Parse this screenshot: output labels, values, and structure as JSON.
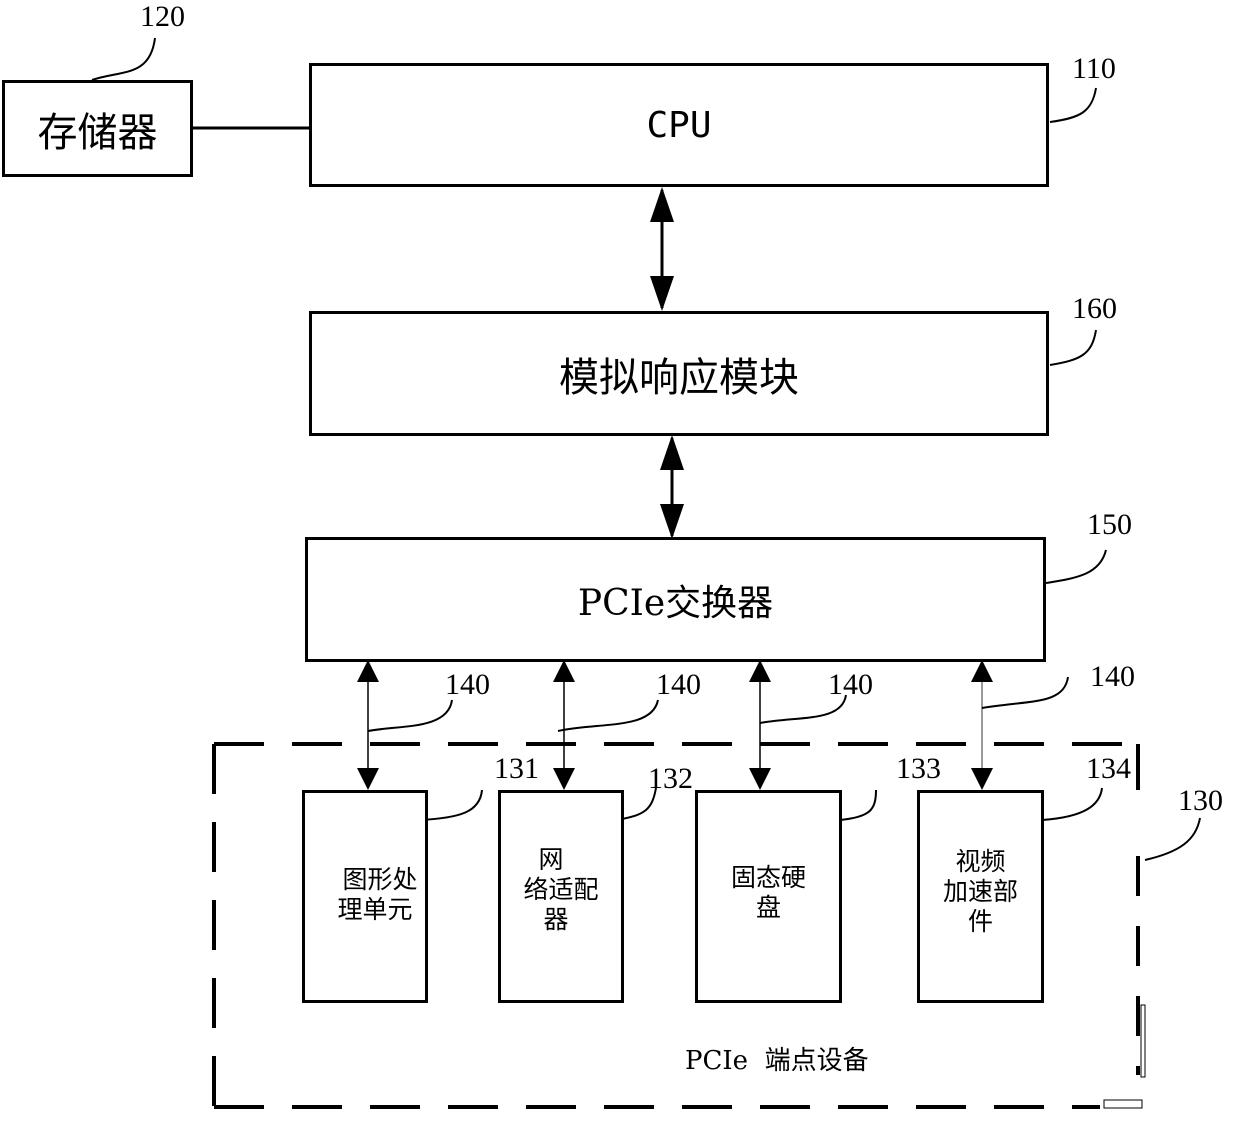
{
  "blocks": {
    "memory": {
      "label": "存储器",
      "ref": "120"
    },
    "cpu": {
      "label": "CPU",
      "ref": "110"
    },
    "sim_response": {
      "label": "模拟响应模块",
      "ref": "160"
    },
    "pcie_switch": {
      "label": "PCIe交换器",
      "ref": "150"
    }
  },
  "links": {
    "ref": "140"
  },
  "endpoint_group": {
    "ref": "130",
    "caption": "PCIe  端点设备",
    "devices": [
      {
        "ref": "131",
        "lines": [
          "图形处",
          "理单元"
        ]
      },
      {
        "ref": "132",
        "lines": [
          "网",
          "络适配",
          "器"
        ]
      },
      {
        "ref": "133",
        "lines": [
          "固态硬",
          "盘"
        ]
      },
      {
        "ref": "134",
        "lines": [
          "视频",
          "加速部",
          "件"
        ]
      }
    ]
  }
}
